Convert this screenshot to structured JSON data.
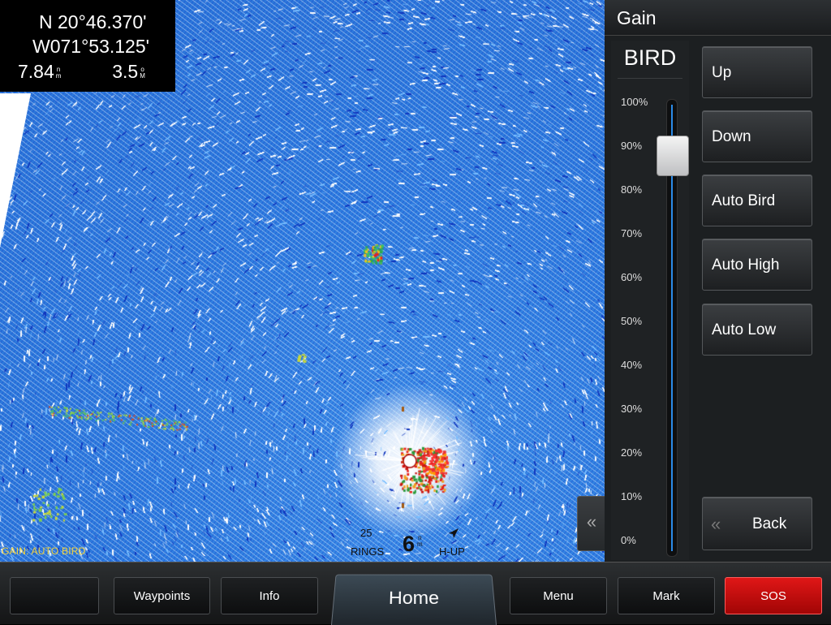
{
  "position": {
    "lat": "N  20°46.370'",
    "lon": "W071°53.125'",
    "speed_value": "7.84",
    "speed_unit_top": "n",
    "speed_unit_bottom": "m",
    "depth_value": "3.5",
    "depth_unit_top": "o",
    "depth_unit_bottom": "M"
  },
  "radar": {
    "gain_status": "GAIN: AUTO BIRD",
    "rings_count": "25",
    "rings_label": "RINGS",
    "range_value": "6",
    "range_unit_top": "n",
    "range_unit_bottom": "m",
    "orientation_label": "H-UP",
    "collapse_glyph": "«"
  },
  "panel": {
    "title": "Gain",
    "mode": "BIRD",
    "slider_value_percent": 88,
    "ticks": [
      "100%",
      "90%",
      "80%",
      "70%",
      "60%",
      "50%",
      "40%",
      "30%",
      "20%",
      "10%",
      "0%"
    ],
    "buttons": [
      "Up",
      "Down",
      "Auto Bird",
      "Auto High",
      "Auto Low"
    ],
    "back_label": "Back",
    "back_glyph": "«"
  },
  "bottom_bar": {
    "waypoints": "Waypoints",
    "info": "Info",
    "home": "Home",
    "menu": "Menu",
    "mark": "Mark",
    "sos": "SOS"
  },
  "colors": {
    "radar_blue": "#2f7ee0",
    "sos_red": "#d40f0f",
    "slider_accent": "#2b8be8",
    "gain_status": "#f3d23a"
  }
}
